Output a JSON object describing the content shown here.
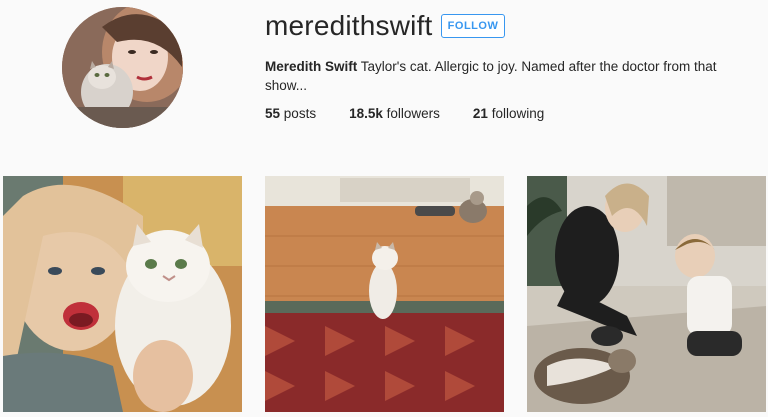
{
  "profile": {
    "username": "meredithswift",
    "follow_label": "FOLLOW",
    "display_name": "Meredith Swift",
    "bio": " Taylor's cat. Allergic to joy. Named after the doctor from that show...",
    "avatar_icon": "profile-photo"
  },
  "stats": {
    "posts_count": "55",
    "posts_label": "posts",
    "followers_count": "18.5k",
    "followers_label": "followers",
    "following_count": "21",
    "following_label": "following"
  },
  "colors": {
    "accent": "#3897f0",
    "text": "#262626",
    "background": "#fafafa"
  }
}
